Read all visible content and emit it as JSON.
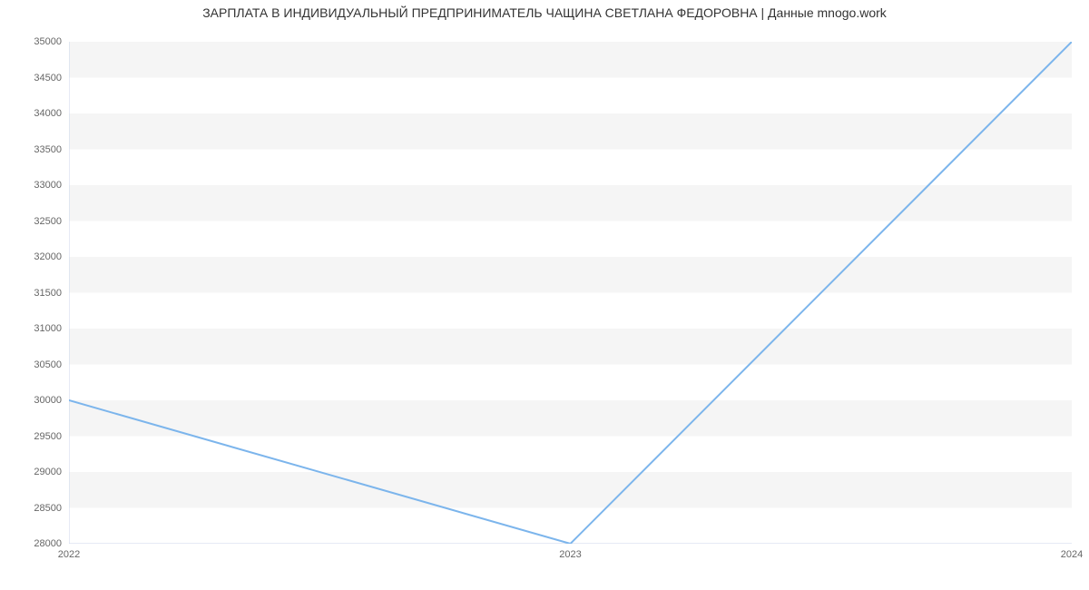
{
  "chart_data": {
    "type": "line",
    "title": "ЗАРПЛАТА В ИНДИВИДУАЛЬНЫЙ ПРЕДПРИНИМАТЕЛЬ ЧАЩИНА СВЕТЛАНА ФЕДОРОВНА | Данные mnogo.work",
    "x": [
      2022,
      2023,
      2024
    ],
    "values": [
      30000,
      28000,
      35000
    ],
    "xlabel": "",
    "ylabel": "",
    "ylim": [
      28000,
      35000
    ],
    "y_ticks": [
      28000,
      28500,
      29000,
      29500,
      30000,
      30500,
      31000,
      31500,
      32000,
      32500,
      33000,
      33500,
      34000,
      34500,
      35000
    ],
    "x_ticks": [
      2022,
      2023,
      2024
    ],
    "grid": true,
    "line_color": "#7cb5ec",
    "axis_color": "#ccd6eb",
    "band_color": "#f5f5f5"
  }
}
